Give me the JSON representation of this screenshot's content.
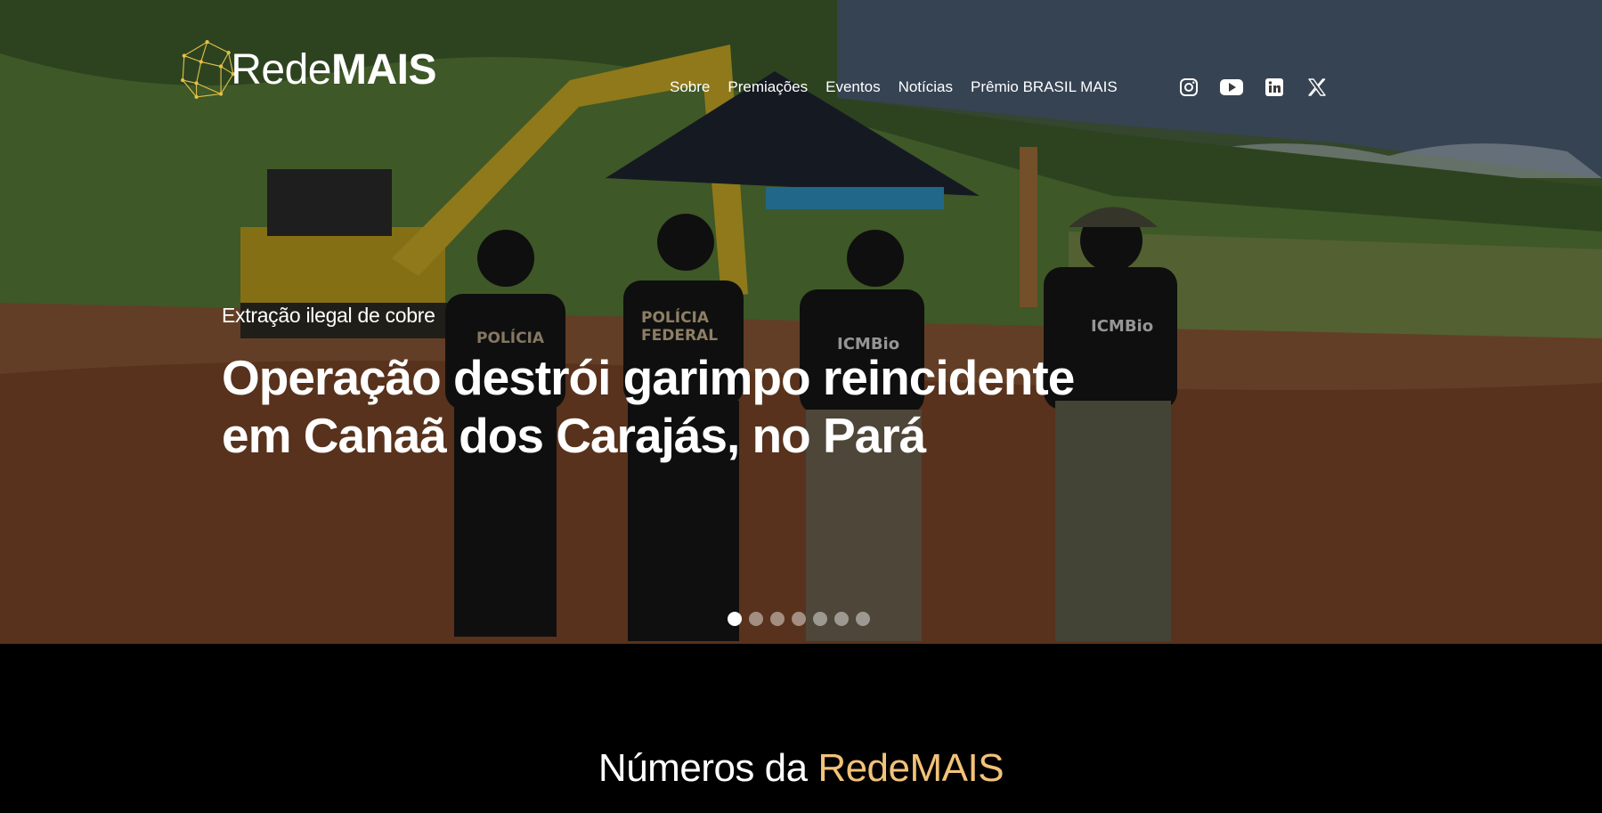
{
  "brand": {
    "name_part1": "Rede",
    "name_part2": "MAIS"
  },
  "nav": {
    "items": [
      {
        "label": "Sobre"
      },
      {
        "label": "Premiações"
      },
      {
        "label": "Eventos"
      },
      {
        "label": "Notícias"
      },
      {
        "label": "Prêmio BRASIL MAIS"
      }
    ],
    "social": [
      "instagram-icon",
      "youtube-icon",
      "linkedin-icon",
      "x-icon"
    ]
  },
  "hero": {
    "kicker": "Extração ilegal de cobre",
    "headline": "Operação destrói garimpo reincidente em Canaã dos Carajás, no Pará",
    "slide_count": 7,
    "active_slide": 1
  },
  "numbers": {
    "title_prefix": "Números da ",
    "title_accent": "RedeMAIS"
  },
  "colors": {
    "accent": "#f2c27a",
    "logo_gold": "#e2c04a",
    "background": "#000000"
  }
}
